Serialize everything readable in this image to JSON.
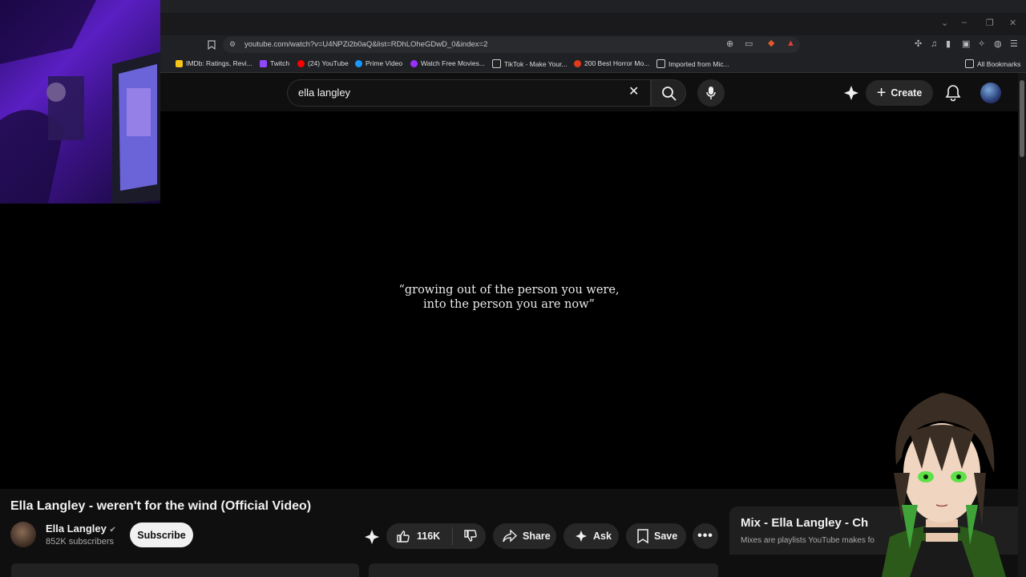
{
  "browser": {
    "url": "youtube.com/watch?v=U4NPZi2b0aQ&list=RDhLOheGDwD_0&index=2",
    "bookmarks": [
      {
        "label": "IMDb: Ratings, Revi...",
        "color": "#f5c518"
      },
      {
        "label": "Twitch",
        "color": "#9146ff"
      },
      {
        "label": "(24) YouTube",
        "color": "#ff0000"
      },
      {
        "label": "Prime Video",
        "color": "#1a98ff"
      },
      {
        "label": "Watch Free Movies...",
        "color": "#9b30ff"
      },
      {
        "label": "TikTok - Make Your...",
        "color": "#222222"
      },
      {
        "label": "200 Best Horror Mo...",
        "color": "#e23b1c"
      },
      {
        "label": "Imported from Mic...",
        "color": "folder"
      }
    ],
    "all_bookmarks": "All Bookmarks"
  },
  "youtube": {
    "search_query": "ella langley",
    "create_label": "Create",
    "video_caption_line1": "“growing out of the person you were,",
    "video_caption_line2": "into the person you are now”",
    "video_title": "Ella Langley - weren't for the wind (Official Video)",
    "channel_name": "Ella Langley",
    "subscribers": "852K subscribers",
    "subscribe_label": "Subscribe",
    "like_count": "116K",
    "share_label": "Share",
    "ask_label": "Ask",
    "save_label": "Save",
    "mix_title": "Mix - Ella Langley - Ch",
    "mix_subtitle": "Mixes are playlists YouTube makes fo"
  },
  "colors": {
    "page_bg": "#0f0f0f",
    "video_bg": "#000000",
    "button_bg": "#272727",
    "subscribe_bg": "#f1f1f1"
  }
}
